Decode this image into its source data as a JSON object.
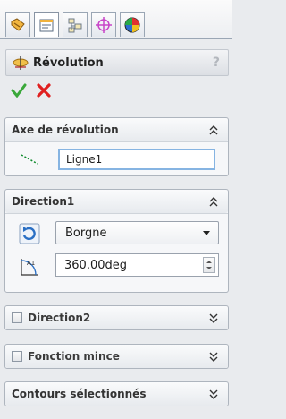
{
  "tabs": [
    {
      "name": "feature-manager-tab",
      "icon": "feature-tree-icon",
      "active": false
    },
    {
      "name": "property-manager-tab",
      "icon": "property-sheet-icon",
      "active": true
    },
    {
      "name": "configuration-manager-tab",
      "icon": "configuration-icon",
      "active": false
    },
    {
      "name": "dimxpert-manager-tab",
      "icon": "crosshair-target-icon",
      "active": false
    },
    {
      "name": "display-manager-tab",
      "icon": "appearance-sphere-icon",
      "active": false
    }
  ],
  "panel": {
    "title": "Révolution",
    "title_icon": "revolve-feature-icon",
    "help": "?"
  },
  "actions": {
    "ok_icon": "green-check-icon",
    "cancel_icon": "red-x-icon"
  },
  "axis_group": {
    "header": "Axe de révolution",
    "field_value": "Ligne1"
  },
  "direction1": {
    "header": "Direction1",
    "end_condition": "Borgne",
    "angle": "360.00deg"
  },
  "direction2": {
    "header": "Direction2"
  },
  "thin_feature": {
    "header": "Fonction mince"
  },
  "selected_contours": {
    "header": "Contours sélectionnés"
  },
  "colors": {
    "accent_field_border": "#86b4e2",
    "ok_green": "#3aa83a",
    "cancel_red": "#e02020"
  }
}
